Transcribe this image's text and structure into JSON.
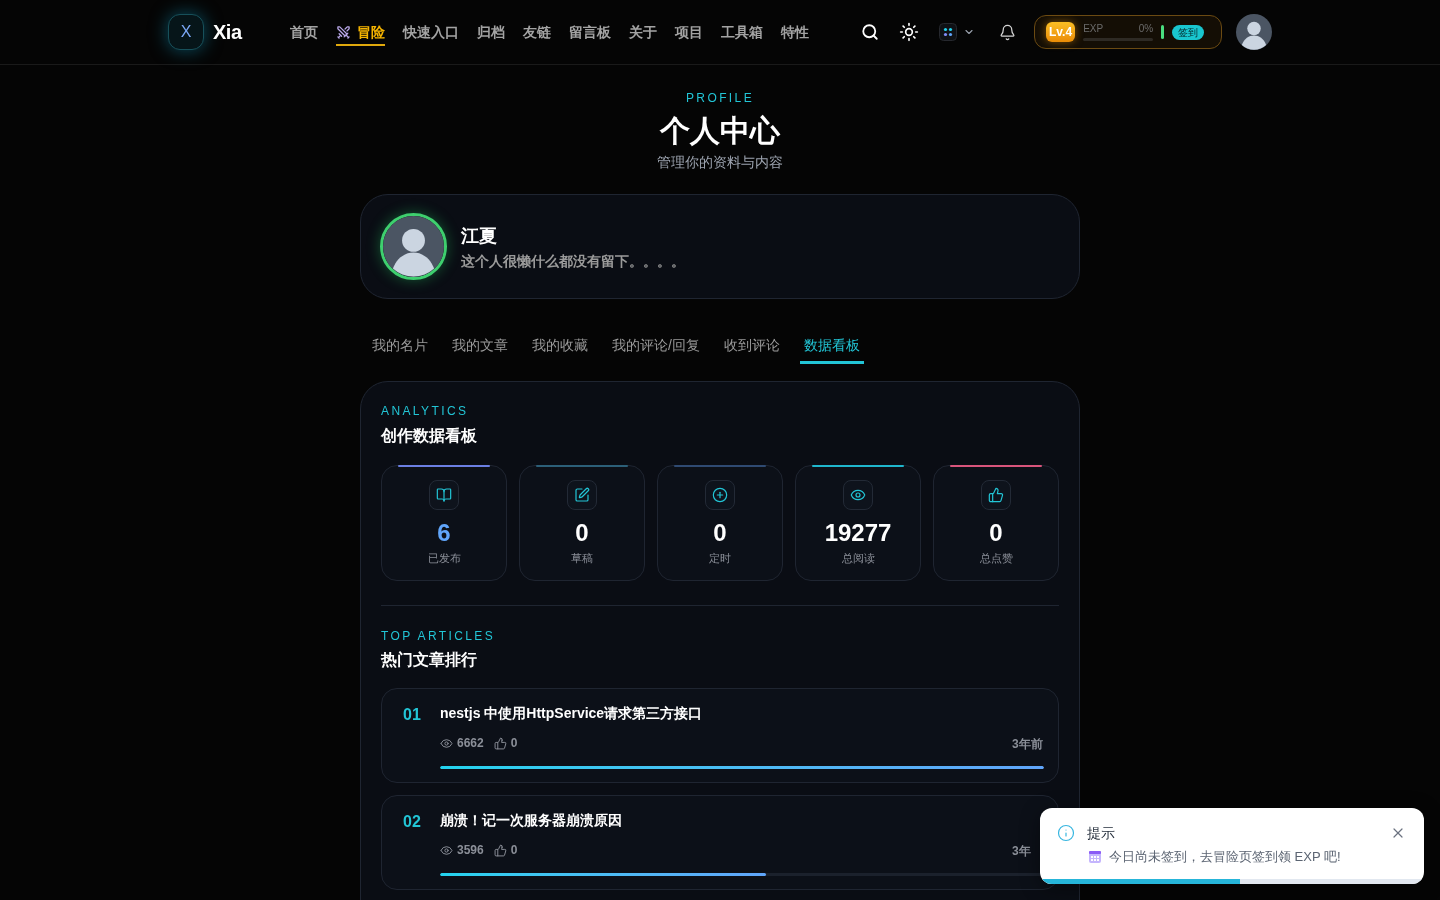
{
  "header": {
    "logo_mark": "X",
    "logo_text": "Xia",
    "nav": [
      {
        "label": "首页",
        "highlighted": false
      },
      {
        "label": "冒险",
        "highlighted": true
      },
      {
        "label": "快速入口",
        "highlighted": false
      },
      {
        "label": "归档",
        "highlighted": false
      },
      {
        "label": "友链",
        "highlighted": false
      },
      {
        "label": "留言板",
        "highlighted": false
      },
      {
        "label": "关于",
        "highlighted": false
      },
      {
        "label": "项目",
        "highlighted": false
      },
      {
        "label": "工具箱",
        "highlighted": false
      },
      {
        "label": "特性",
        "highlighted": false
      }
    ],
    "level_panel": {
      "badge": "Lv.4",
      "exp_label": "EXP",
      "exp_percent": "0%",
      "level": 0,
      "check_in": "签到"
    }
  },
  "page_header": {
    "eyebrow": "PROFILE",
    "title": "个人中心",
    "subtitle": "管理你的资料与内容"
  },
  "profile": {
    "name": "江夏",
    "bio": "这个人很懒什么都没有留下。。。。"
  },
  "tabs": [
    {
      "label": "我的名片",
      "selected": false
    },
    {
      "label": "我的文章",
      "selected": false
    },
    {
      "label": "我的收藏",
      "selected": false
    },
    {
      "label": "我的评论/回复",
      "selected": false
    },
    {
      "label": "收到评论",
      "selected": false
    },
    {
      "label": "数据看板",
      "selected": true
    }
  ],
  "analytics": {
    "eyebrow": "ANALYTICS",
    "title": "创作数据看板",
    "stats": [
      {
        "kind": "published",
        "value": "6",
        "label": "已发布",
        "highlight": true,
        "color": "#6b7fe3"
      },
      {
        "kind": "draft",
        "value": "0",
        "label": "草稿",
        "highlight": false,
        "color": "#2c5f78"
      },
      {
        "kind": "scheduled",
        "value": "0",
        "label": "定时",
        "highlight": false,
        "color": "#2f4a72"
      },
      {
        "kind": "views",
        "value": "19277",
        "label": "总阅读",
        "highlight": false,
        "color": "#1fb6cc"
      },
      {
        "kind": "likes",
        "value": "0",
        "label": "总点赞",
        "highlight": false,
        "color": "#d9557c"
      }
    ]
  },
  "top_articles": {
    "eyebrow": "TOP ARTICLES",
    "title": "热门文章排行",
    "items": [
      {
        "rank": "01",
        "title": "nestjs 中使用HttpService请求第三方接口",
        "views": "6662",
        "likes": "0",
        "time": "3年前",
        "level": 1
      },
      {
        "rank": "02",
        "title": "崩溃！记一次服务器崩溃原因",
        "views": "3596",
        "likes": "0",
        "time": "3年",
        "level": 0.54
      }
    ]
  },
  "toast": {
    "title": "提示",
    "message": "今日尚未签到，去冒险页签到领 EXP 吧!",
    "level": 0.52
  }
}
